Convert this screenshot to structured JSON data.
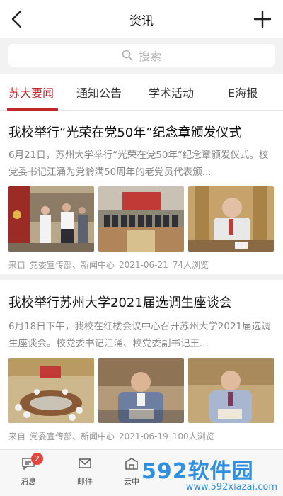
{
  "header": {
    "title": "资讯"
  },
  "search": {
    "placeholder": "搜索"
  },
  "tabs": [
    {
      "label": "苏大要闻",
      "active": true
    },
    {
      "label": "通知公告",
      "active": false
    },
    {
      "label": "学术活动",
      "active": false
    },
    {
      "label": "E海报",
      "active": false
    }
  ],
  "articles": [
    {
      "title": "我校举行“光荣在党50年”纪念章颁发仪式",
      "summary": "6月21日，苏州大学举行“光荣在党50年”纪念章颁发仪式。校党委书记江涌为党龄满50周年的老党员代表颁...",
      "source": "来自",
      "org": "党委宣传部、新闻中心",
      "date": "2021-06-21",
      "views": "74人浏览"
    },
    {
      "title": "我校举行苏州大学2021届选调生座谈会",
      "summary": "6月18日下午，我校在红楼会议中心召开苏州大学2021届选调生座谈会。校党委书记江涌、校党委副书记王...",
      "source": "来自",
      "org": "党委宣传部、新闻中心",
      "date": "2021-06-19",
      "views": "100人浏览"
    }
  ],
  "bottom_nav": [
    {
      "label": "消息",
      "badge": "2"
    },
    {
      "label": "邮件"
    },
    {
      "label": "云中"
    }
  ],
  "watermark": {
    "main": "592软件园",
    "url": "www.592xiazai.com"
  },
  "colors": {
    "accent": "#c0282d",
    "watermark": "#2f8fe0",
    "badge": "#e5463b"
  }
}
